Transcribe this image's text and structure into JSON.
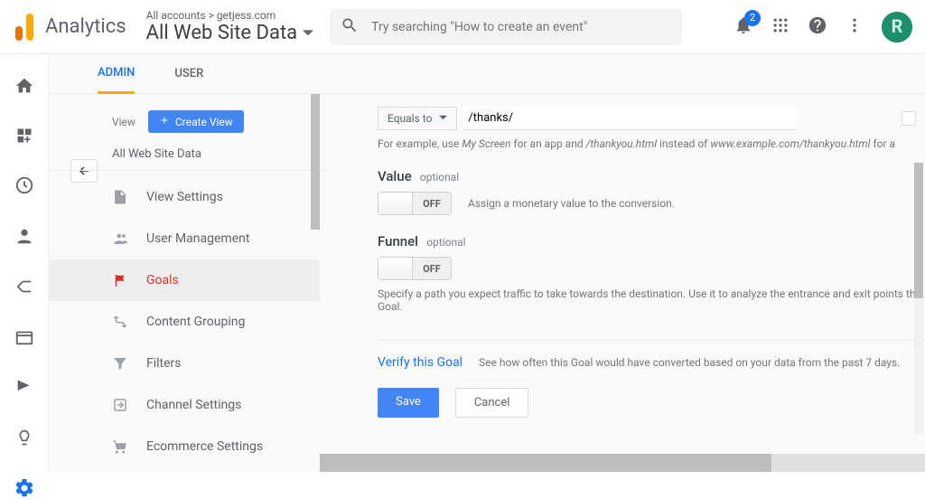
{
  "header": {
    "product": "Analytics",
    "breadcrumb": "All accounts > getjess.com",
    "view_selector": "All Web Site Data",
    "search_placeholder": "Try searching \"How to create an event\"",
    "notif_count": "2",
    "avatar_initial": "R"
  },
  "tabs": {
    "admin": "ADMIN",
    "user": "USER"
  },
  "column": {
    "label": "View",
    "create_btn": "Create View",
    "view_name": "All Web Site Data",
    "items": [
      {
        "label": "View Settings"
      },
      {
        "label": "User Management"
      },
      {
        "label": "Goals"
      },
      {
        "label": "Content Grouping"
      },
      {
        "label": "Filters"
      },
      {
        "label": "Channel Settings"
      },
      {
        "label": "Ecommerce Settings"
      }
    ]
  },
  "goal": {
    "match_type": "Equals to",
    "destination": "/thanks/",
    "example_prefix": "For example, use ",
    "example_em1": "My Screen",
    "example_mid": " for an app and ",
    "example_em2": "/thankyou.html",
    "example_mid2": " instead of ",
    "example_em3": "www.example.com/thankyou.html",
    "example_end": " for a",
    "value_label": "Value",
    "value_optional": "optional",
    "value_toggle": "OFF",
    "value_desc": "Assign a monetary value to the conversion.",
    "funnel_label": "Funnel",
    "funnel_optional": "optional",
    "funnel_toggle": "OFF",
    "funnel_desc": "Specify a path you expect traffic to take towards the destination. Use it to analyze the entrance and exit points the Goal.",
    "verify_link": "Verify this Goal",
    "verify_desc": "See how often this Goal would have converted based on your data from the past 7 days.",
    "save": "Save",
    "cancel": "Cancel"
  }
}
